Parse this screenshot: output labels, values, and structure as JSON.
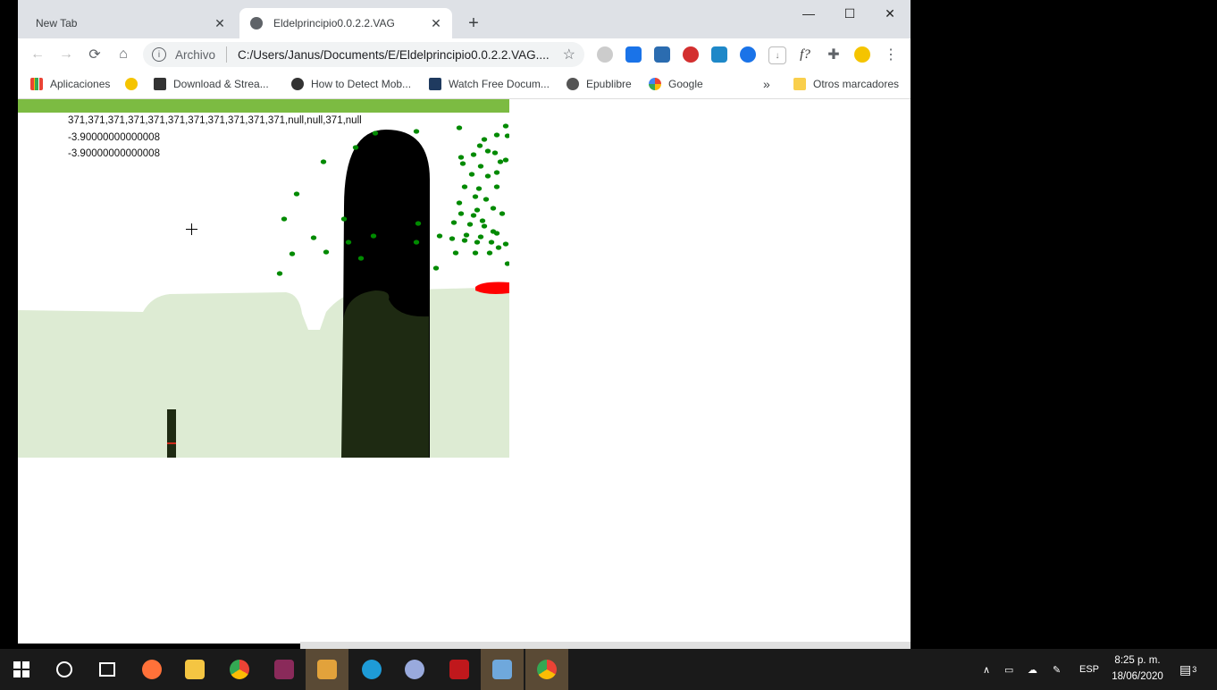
{
  "browser": {
    "tabs": [
      {
        "title": "New Tab",
        "active": false
      },
      {
        "title": "Eldelprincipio0.0.2.2.VAG",
        "active": true
      }
    ],
    "new_tab_symbol": "+",
    "window_controls": {
      "minimize": "—",
      "maximize": "☐",
      "close": "✕"
    },
    "omnibox": {
      "security_label": "Archivo",
      "url": "C:/Users/Janus/Documents/E/Eldelprincipio0.0.2.2.VAG...."
    },
    "bookmarks": [
      {
        "label": "Aplicaciones",
        "icon": "apps-grid-icon"
      },
      {
        "label": "",
        "icon": "smiley-icon"
      },
      {
        "label": "Download & Strea...",
        "icon": "museum-icon"
      },
      {
        "label": "How to Detect Mob...",
        "icon": "diamond-icon"
      },
      {
        "label": "Watch Free Docum...",
        "icon": "dh-icon"
      },
      {
        "label": "Epublibre",
        "icon": "bird-icon"
      },
      {
        "label": "Google",
        "icon": "google-icon"
      }
    ],
    "bookmarks_overflow": "»",
    "other_bookmarks": "Otros marcadores",
    "extensions_f_label": "f?"
  },
  "game": {
    "debug_lines": [
      "371,371,371,371,371,371,371,371,371,371,371,null,null,371,null",
      "-3.90000000000008",
      "-3.90000000000008"
    ],
    "colors": {
      "top_bar": "#7cbb42",
      "ground": "#ddebd3",
      "tree_trunk": "#000000",
      "tree_base": "#1e2a12",
      "leaves": "#008a00",
      "red_blob": "#ff0000"
    }
  },
  "taskbar": {
    "apps": [
      "start-icon",
      "cortana-icon",
      "task-view-icon",
      "firefox-icon",
      "file-explorer-icon",
      "chrome-icon",
      "video-editor-icon",
      "winamp-icon",
      "edge-icon",
      "paint-icon",
      "flash-icon",
      "app-icon",
      "chrome-profile-icon"
    ],
    "language": "ESP",
    "time": "8:25 p. m.",
    "date": "18/06/2020",
    "notification_count": "3"
  }
}
